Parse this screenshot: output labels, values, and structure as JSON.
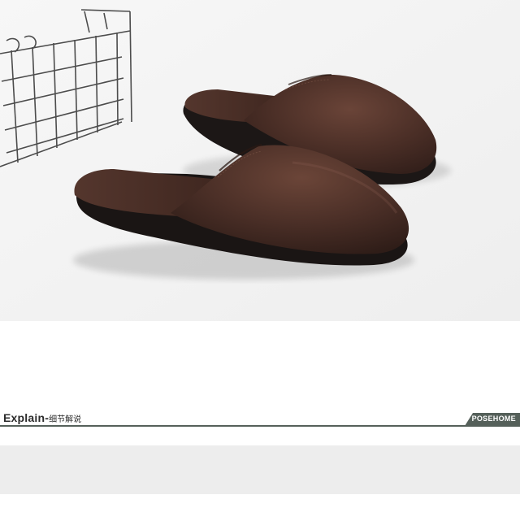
{
  "photo": {
    "subject": "pair of brown leather slippers with wire basket",
    "colors": {
      "background": "#f4f4f4",
      "leather": "#4a2e26",
      "sole": "#1c1716",
      "wire": "#3a3a3a"
    }
  },
  "section_header": {
    "title_en": "Explain",
    "title_cn": "细节解说",
    "brand": "POSEHOME",
    "accent_color": "#55605a"
  }
}
